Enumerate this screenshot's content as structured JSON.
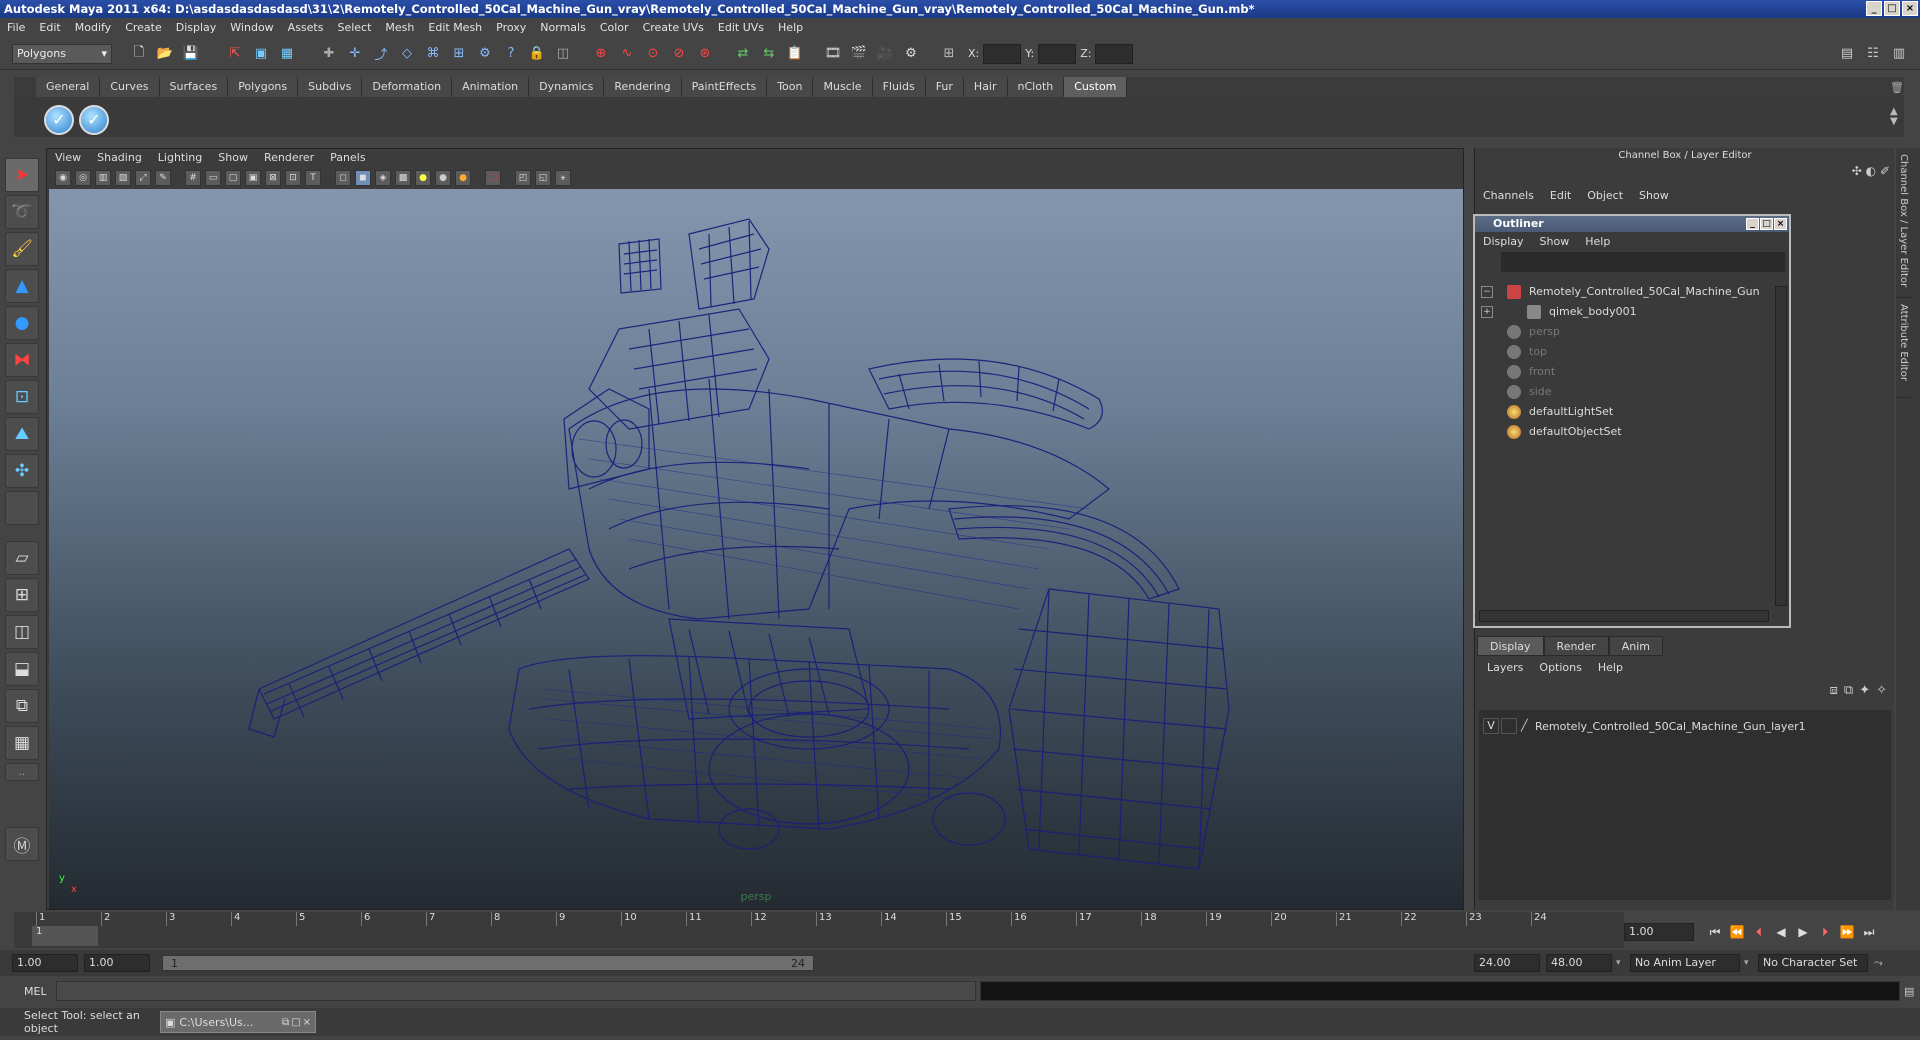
{
  "title": "Autodesk Maya 2011 x64: D:\\asdasdasdasdasd\\31\\2\\Remotely_Controlled_50Cal_Machine_Gun_vray\\Remotely_Controlled_50Cal_Machine_Gun_vray\\Remotely_Controlled_50Cal_Machine_Gun.mb*",
  "menu": [
    "File",
    "Edit",
    "Modify",
    "Create",
    "Display",
    "Window",
    "Assets",
    "Select",
    "Mesh",
    "Edit Mesh",
    "Proxy",
    "Normals",
    "Color",
    "Create UVs",
    "Edit UVs",
    "Help"
  ],
  "status": {
    "mode": "Polygons",
    "x_label": "X:",
    "y_label": "Y:",
    "z_label": "Z:"
  },
  "shelf_tabs": [
    "General",
    "Curves",
    "Surfaces",
    "Polygons",
    "Subdivs",
    "Deformation",
    "Animation",
    "Dynamics",
    "Rendering",
    "PaintEffects",
    "Toon",
    "Muscle",
    "Fluids",
    "Fur",
    "Hair",
    "nCloth",
    "Custom"
  ],
  "shelf_active": "Custom",
  "viewport": {
    "menu": [
      "View",
      "Shading",
      "Lighting",
      "Show",
      "Renderer",
      "Panels"
    ],
    "camera_label": "persp",
    "axis_y": "y",
    "axis_x": "x",
    "wire_color": "#1a1e7a"
  },
  "channel_box": {
    "title": "Channel Box / Layer Editor",
    "menu": [
      "Channels",
      "Edit",
      "Object",
      "Show"
    ]
  },
  "outliner": {
    "title": "Outliner",
    "menu": [
      "Display",
      "Show",
      "Help"
    ],
    "items": [
      {
        "label": "Remotely_Controlled_50Cal_Machine_Gun",
        "expand": "−",
        "dim": false
      },
      {
        "label": "qimek_body001",
        "expand": "+",
        "dim": false
      },
      {
        "label": "persp",
        "expand": "",
        "dim": true
      },
      {
        "label": "top",
        "expand": "",
        "dim": true
      },
      {
        "label": "front",
        "expand": "",
        "dim": true
      },
      {
        "label": "side",
        "expand": "",
        "dim": true
      },
      {
        "label": "defaultLightSet",
        "expand": "",
        "dim": false
      },
      {
        "label": "defaultObjectSet",
        "expand": "",
        "dim": false
      }
    ]
  },
  "layer_editor": {
    "tabs": [
      "Display",
      "Render",
      "Anim"
    ],
    "menu": [
      "Layers",
      "Options",
      "Help"
    ],
    "layer_visible": "V",
    "layer_name": "Remotely_Controlled_50Cal_Machine_Gun_layer1"
  },
  "side_tabs": [
    "Channel Box / Layer Editor",
    "Attribute Editor"
  ],
  "time": {
    "ticks": [
      "1",
      "2",
      "3",
      "4",
      "5",
      "6",
      "7",
      "8",
      "9",
      "10",
      "11",
      "12",
      "13",
      "14",
      "15",
      "16",
      "17",
      "18",
      "19",
      "20",
      "21",
      "22",
      "23",
      "24"
    ],
    "current_frame_marker": "1",
    "current_time": "1.00",
    "range_start": "1.00",
    "playback_start": "1.00",
    "range_slider_start": "1",
    "range_slider_end": "24",
    "playback_end": "24.00",
    "range_end": "48.00",
    "anim_layer": "No Anim Layer",
    "character_set": "No Character Set"
  },
  "command": {
    "label": "MEL"
  },
  "help_line": "Select Tool: select an object",
  "taskbar_item": "C:\\Users\\Us..."
}
